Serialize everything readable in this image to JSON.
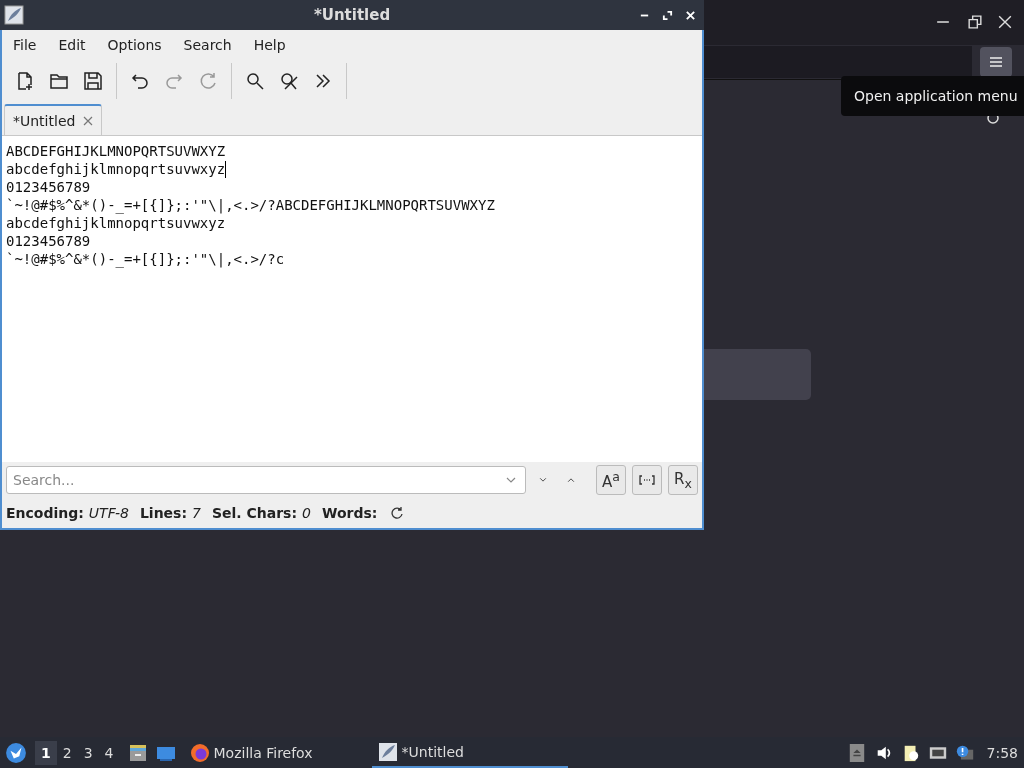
{
  "background_window": {
    "tooltip": "Open application menu"
  },
  "editor": {
    "title": "*Untitled",
    "menu": [
      "File",
      "Edit",
      "Options",
      "Search",
      "Help"
    ],
    "toolbar": [
      {
        "kind": "new",
        "disabled": false
      },
      {
        "kind": "open",
        "disabled": false
      },
      {
        "kind": "save",
        "disabled": false
      },
      {
        "kind": "sep"
      },
      {
        "kind": "undo",
        "disabled": false
      },
      {
        "kind": "redo",
        "disabled": true
      },
      {
        "kind": "reload",
        "disabled": true
      },
      {
        "kind": "sep"
      },
      {
        "kind": "find",
        "disabled": false
      },
      {
        "kind": "replace",
        "disabled": false
      },
      {
        "kind": "more",
        "disabled": false
      },
      {
        "kind": "sep"
      }
    ],
    "tabs": [
      {
        "label": "*Untitled",
        "selected": true
      }
    ],
    "lines": [
      {
        "text": "ABCDEFGHIJKLMNOPQRTSUVWXYZ",
        "cursor": false
      },
      {
        "text": "abcdefghijklmnopqrtsuvwxyz",
        "cursor": true
      },
      {
        "text": "0123456789",
        "cursor": false
      },
      {
        "text": "`~!@#$%^&*()-_=+[{]};:'\"\\|,<.>/?ABCDEFGHIJKLMNOPQRTSUVWXYZ",
        "cursor": false
      },
      {
        "text": "abcdefghijklmnopqrtsuvwxyz",
        "cursor": false
      },
      {
        "text": "0123456789",
        "cursor": false
      },
      {
        "text": "`~!@#$%^&*()-_=+[{]};:'\"\\|,<.>/?c",
        "cursor": false
      }
    ],
    "search": {
      "placeholder": "Search...",
      "options": [
        {
          "kind": "case",
          "label": "A$^{a}$"
        },
        {
          "kind": "whole"
        },
        {
          "kind": "regex",
          "label": "R$_{x}$"
        }
      ]
    },
    "status": [
      {
        "label": "Encoding:",
        "value": "UTF-8"
      },
      {
        "label": "Lines:",
        "value": "7"
      },
      {
        "label": "Sel. Chars:",
        "value": "0"
      },
      {
        "label": "Words:"
      }
    ]
  },
  "taskbar": {
    "workspaces": [
      {
        "label": "1",
        "selected": true
      },
      {
        "label": "2",
        "selected": false
      },
      {
        "label": "3",
        "selected": false
      },
      {
        "label": "4",
        "selected": false
      }
    ],
    "tasks": [
      {
        "kind": "firefox",
        "label": "Mozilla Firefox",
        "selected": false
      },
      {
        "kind": "editor",
        "label": "*Untitled",
        "selected": true
      }
    ],
    "clock": "7:58"
  }
}
